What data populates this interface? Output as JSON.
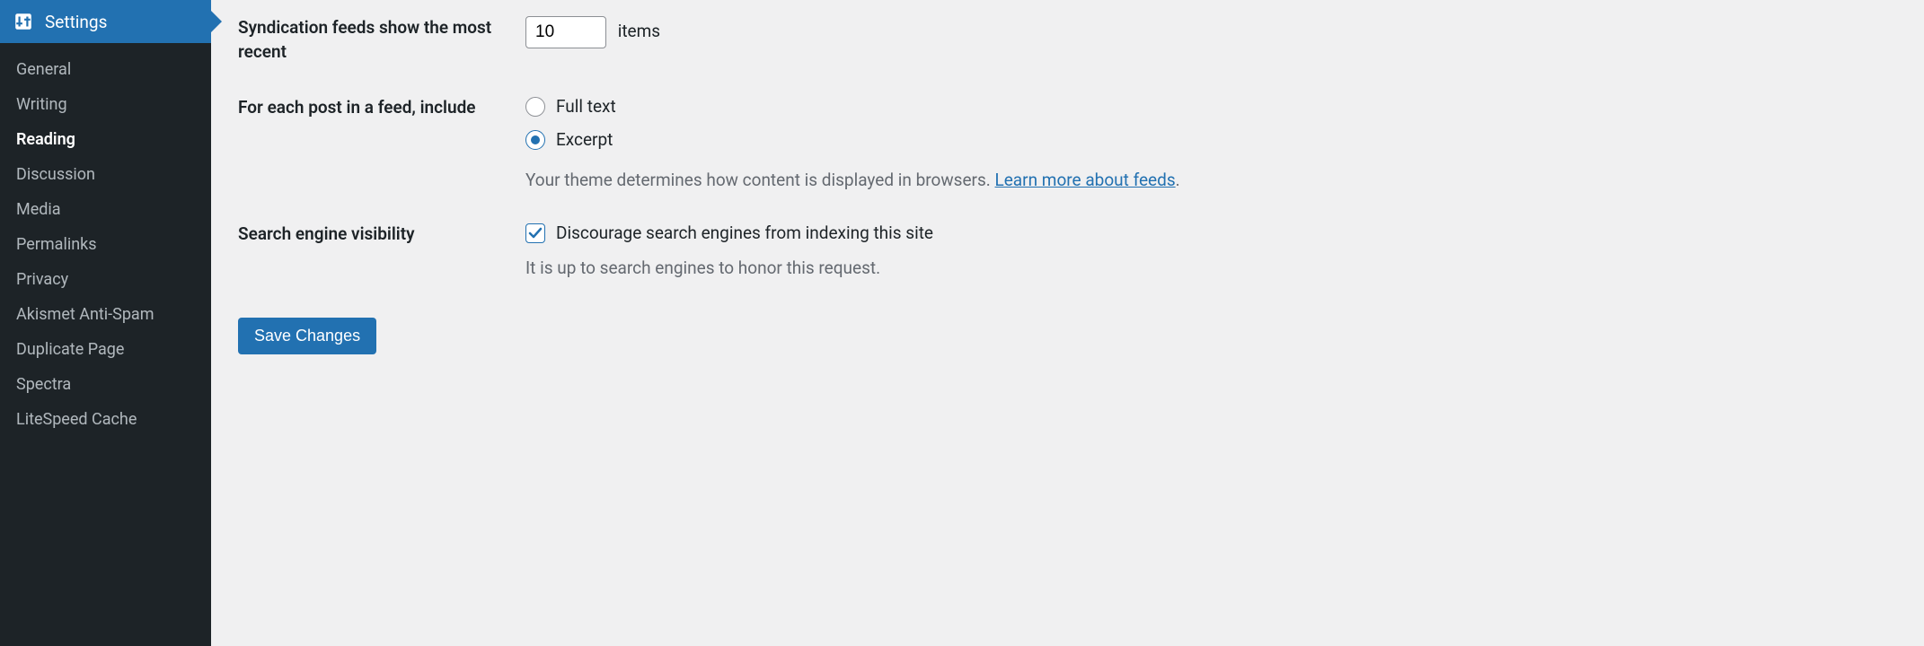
{
  "sidebar": {
    "header_label": "Settings",
    "items": [
      {
        "label": "General",
        "active": false
      },
      {
        "label": "Writing",
        "active": false
      },
      {
        "label": "Reading",
        "active": true
      },
      {
        "label": "Discussion",
        "active": false
      },
      {
        "label": "Media",
        "active": false
      },
      {
        "label": "Permalinks",
        "active": false
      },
      {
        "label": "Privacy",
        "active": false
      },
      {
        "label": "Akismet Anti-Spam",
        "active": false
      },
      {
        "label": "Duplicate Page",
        "active": false
      },
      {
        "label": "Spectra",
        "active": false
      },
      {
        "label": "LiteSpeed Cache",
        "active": false
      }
    ]
  },
  "settings": {
    "syndication": {
      "label": "Syndication feeds show the most recent",
      "value": "10",
      "suffix": "items"
    },
    "feed_content": {
      "label": "For each post in a feed, include",
      "options": {
        "full_text": "Full text",
        "excerpt": "Excerpt"
      },
      "description_text": "Your theme determines how content is displayed in browsers. ",
      "description_link": "Learn more about feeds",
      "description_end": "."
    },
    "search_visibility": {
      "label": "Search engine visibility",
      "checkbox_label": "Discourage search engines from indexing this site",
      "description": "It is up to search engines to honor this request."
    }
  },
  "buttons": {
    "save": "Save Changes"
  }
}
